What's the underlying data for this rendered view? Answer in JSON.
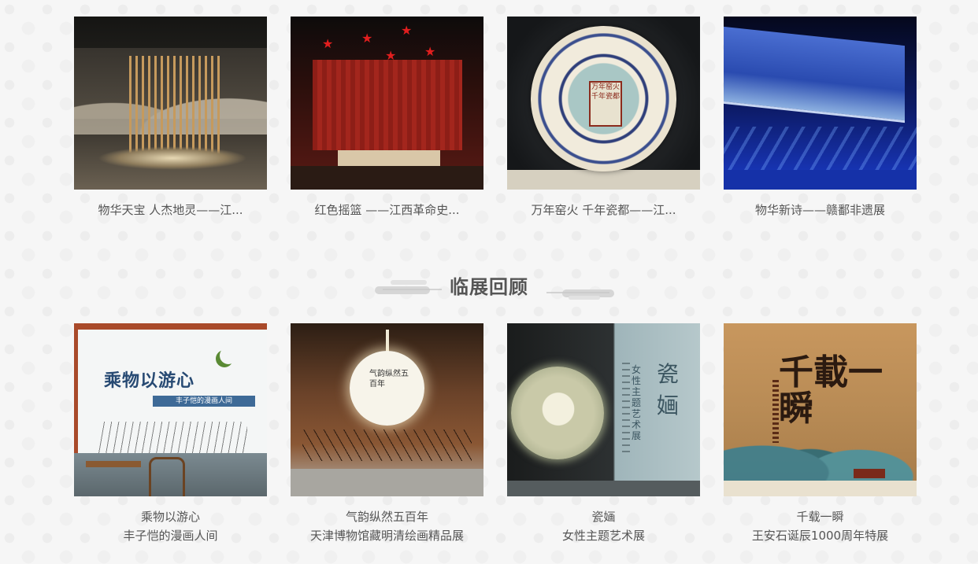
{
  "permanent_exhibitions": [
    {
      "caption": "物华天宝 人杰地灵——江...",
      "image_icon": "exhibit-photo-icon"
    },
    {
      "caption": "红色摇篮 ——江西革命史...",
      "image_icon": "exhibit-photo-icon"
    },
    {
      "caption": "万年窑火 千年瓷都——江...",
      "image_icon": "exhibit-photo-icon"
    },
    {
      "caption": "物华新诗——赣鄱非遗展",
      "image_icon": "exhibit-photo-icon"
    }
  ],
  "review_section": {
    "title": "临展回顾"
  },
  "temporary_exhibitions": [
    {
      "line1": "乘物以游心",
      "line2": "丰子恺的漫画人间"
    },
    {
      "line1": "气韵纵然五百年",
      "line2": "天津博物馆藏明清绘画精品展"
    },
    {
      "line1": "瓷婳",
      "line2": "女性主题艺术展"
    },
    {
      "line1": "千载一瞬",
      "line2": "王安石诞辰1000周年特展"
    }
  ],
  "image_text": {
    "t3_seal": "万年窑火千年瓷都",
    "t5_title": "乘物以游心",
    "t5_band": "丰子恺的漫画人间",
    "t6_text": "气韵纵然五百年",
    "t7_big": "瓷婳",
    "t7_sub": "女性主题艺术展",
    "t8_callig": "千載一瞬"
  },
  "colors": {
    "caption_text": "#555555",
    "title_text": "#555555",
    "background": "#f6f6f6"
  }
}
